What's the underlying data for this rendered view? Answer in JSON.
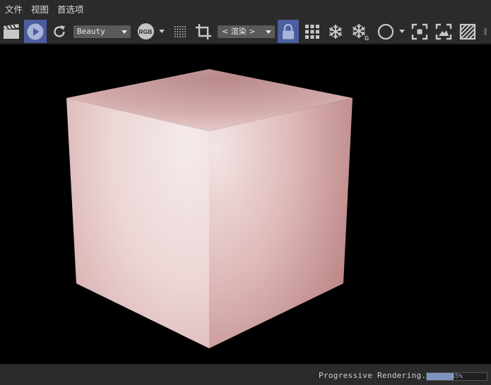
{
  "menu": {
    "items": [
      "文件",
      "视图",
      "首选项"
    ]
  },
  "toolbar": {
    "pass_select": {
      "selected": "Beauty"
    },
    "channel_badge": "RGB",
    "render_mode_select": {
      "selected": "< 渲染 >"
    },
    "icons": [
      "clapperboard-icon",
      "play-icon",
      "refresh-icon",
      "dotted-grid-icon",
      "crop-icon",
      "lock-icon",
      "grid-icon",
      "snowflake-icon",
      "snowflake-g-icon",
      "circle-icon",
      "focus-icon",
      "expand-frame-icon",
      "hatched-square-icon"
    ],
    "accent_color": "#4a5ea0"
  },
  "status": {
    "text": "Progressive Rendering...",
    "progress_value": 45,
    "progress_label": "45%"
  },
  "render": {
    "object": "cube",
    "colors": {
      "light": "#f4e6e6",
      "mid": "#ddb5b5",
      "dark": "#b07878"
    }
  }
}
